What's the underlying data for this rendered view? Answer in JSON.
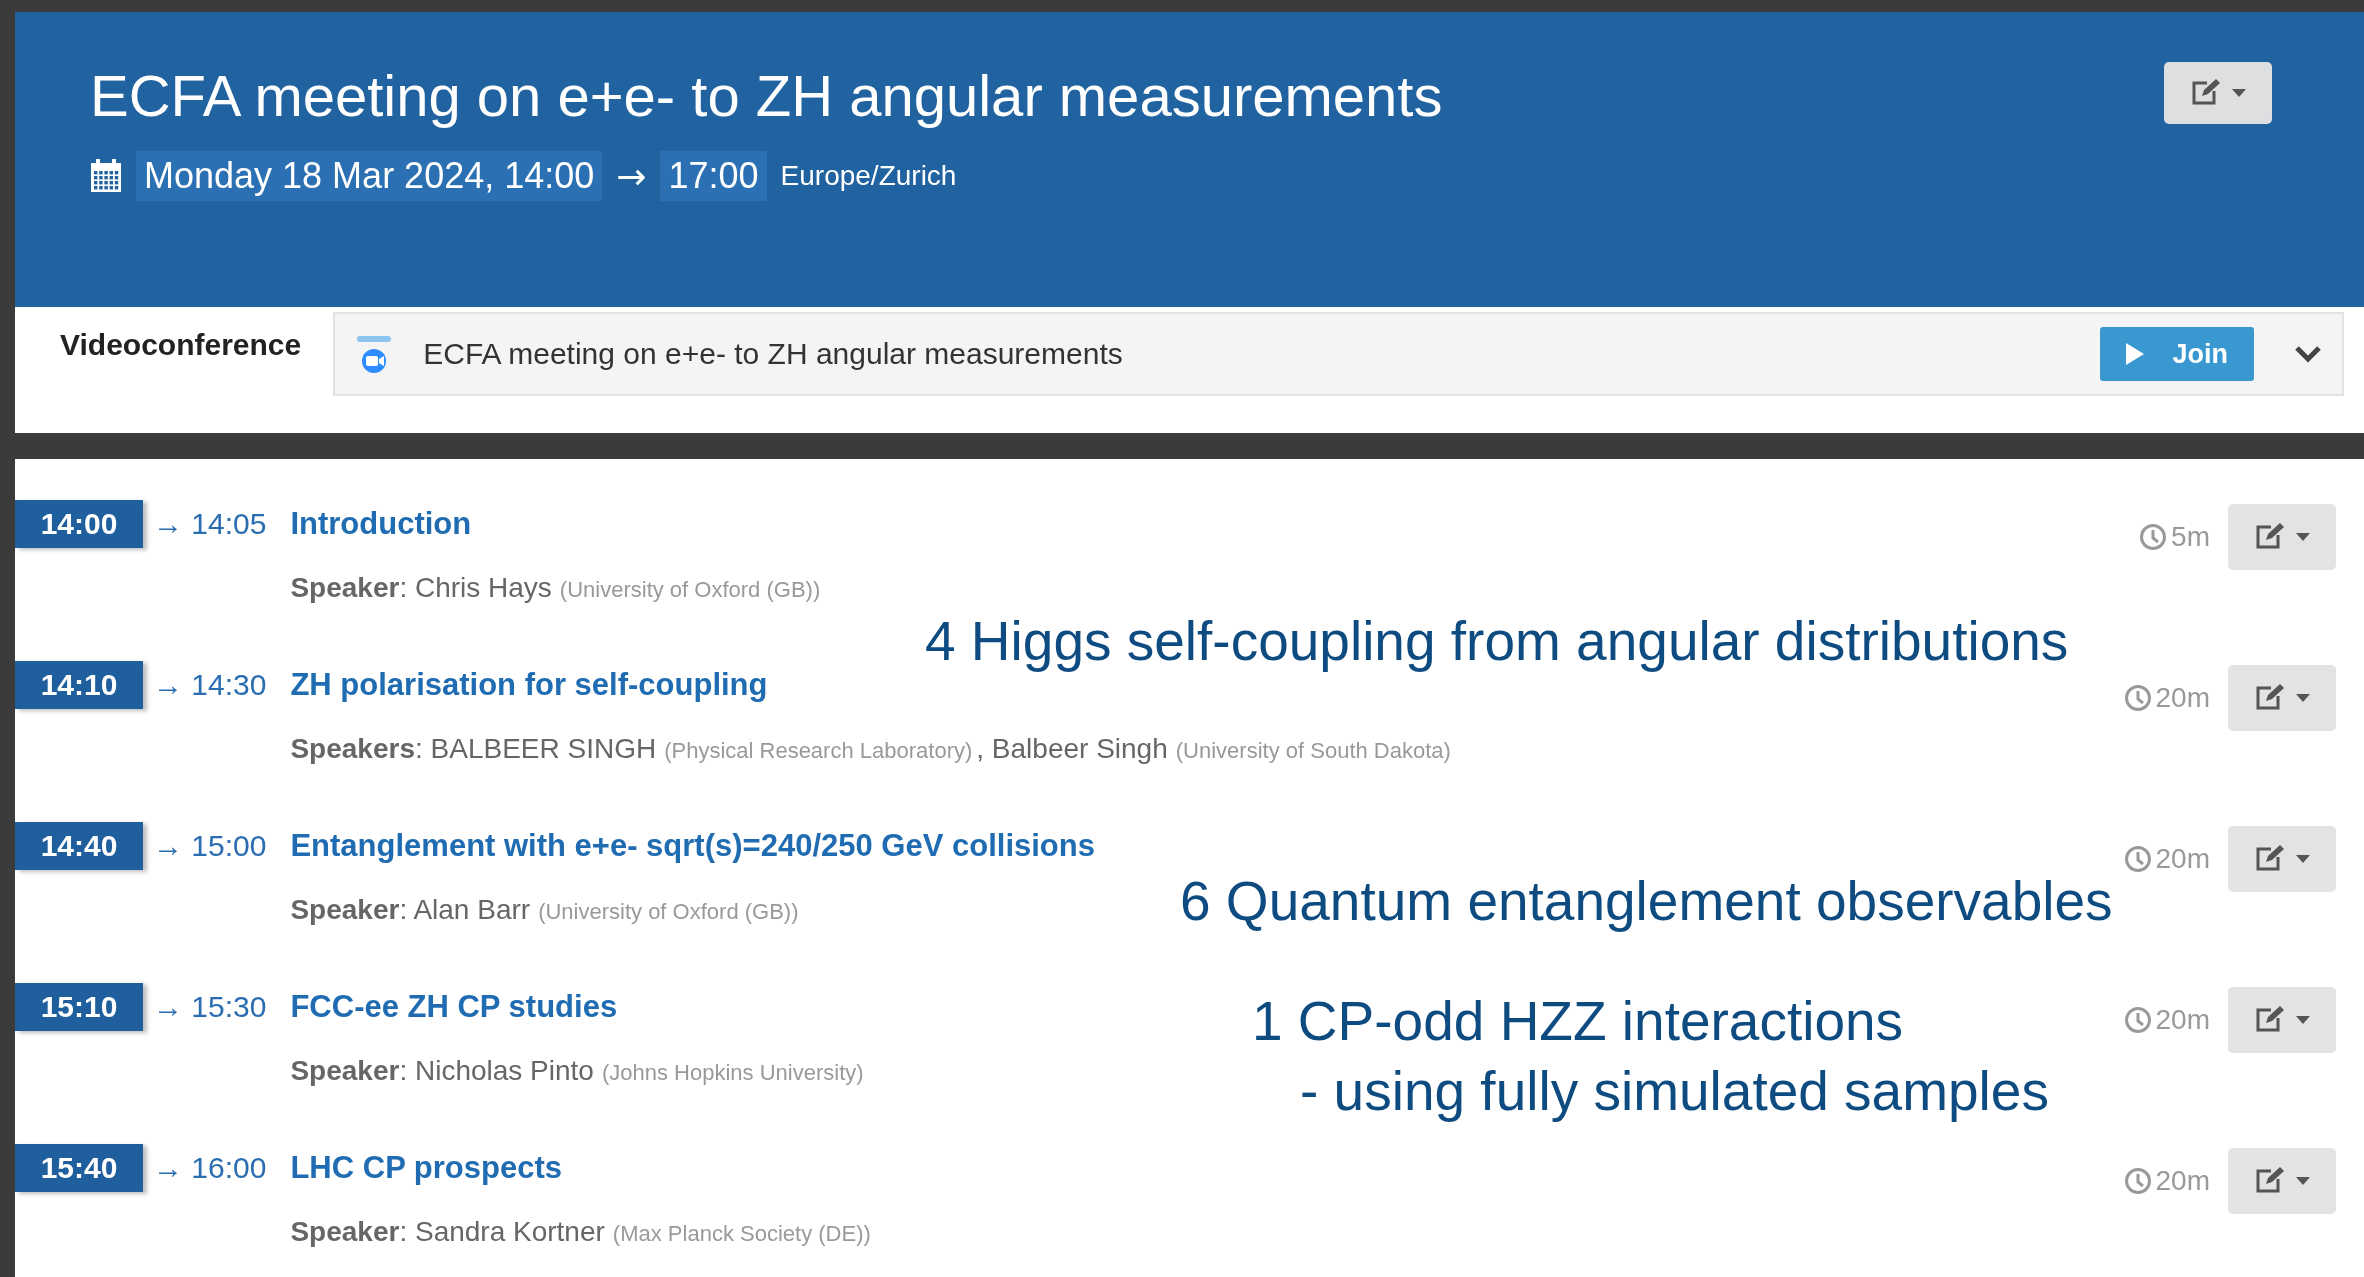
{
  "event": {
    "title": "ECFA meeting on e+e- to ZH angular measurements",
    "start": "Monday 18 Mar 2024, 14:00",
    "arrow": "→",
    "end": "17:00",
    "timezone": "Europe/Zurich"
  },
  "videoconference": {
    "label": "Videoconference",
    "room": "ECFA meeting on e+e- to ZH angular measurements",
    "join": "Join"
  },
  "timetable": [
    {
      "start": "14:00",
      "end": "→ 14:05",
      "title": "Introduction",
      "duration": "5m",
      "speakers": [
        {
          "text": "**Speaker**: Chris Hays",
          "affiliation": "(University of Oxford (GB))"
        }
      ]
    },
    {
      "start": "14:10",
      "end": "→ 14:30",
      "title": "ZH polarisation for self-coupling",
      "duration": "20m",
      "speakers": [
        {
          "text": "**Speakers**: BALBEER SINGH",
          "affiliation": "(Physical Research Laboratory)"
        },
        {
          "text": ", Balbeer Singh",
          "affiliation": "(University of South Dakota)"
        }
      ]
    },
    {
      "start": "14:40",
      "end": "→ 15:00",
      "title": "Entanglement with e+e- sqrt(s)=240/250 GeV collisions",
      "duration": "20m",
      "speakers": [
        {
          "text": "**Speaker**: Alan Barr",
          "affiliation": "(University of Oxford (GB))"
        }
      ]
    },
    {
      "start": "15:10",
      "end": "→ 15:30",
      "title": "FCC-ee ZH CP studies",
      "duration": "20m",
      "speakers": [
        {
          "text": "**Speaker**: Nicholas Pinto",
          "affiliation": "(Johns Hopkins University)"
        }
      ]
    },
    {
      "start": "15:40",
      "end": "→ 16:00",
      "title": "LHC CP prospects",
      "duration": "20m",
      "speakers": [
        {
          "text": "**Speaker**: Sandra Kortner",
          "affiliation": "(Max Planck Society (DE))"
        }
      ]
    }
  ],
  "annotations": [
    {
      "text": "4 Higgs self-coupling from angular distributions"
    },
    {
      "text": "6 Quantum entanglement observables"
    },
    {
      "text": "1 CP-odd HZZ interactions"
    },
    {
      "text": "- using fully simulated samples"
    }
  ]
}
